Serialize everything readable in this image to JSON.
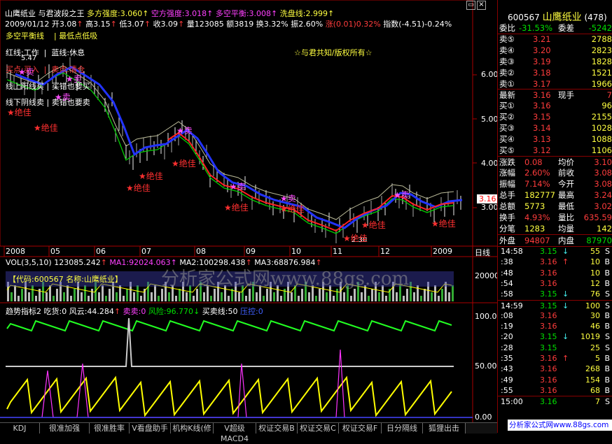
{
  "header": {
    "stock": "山鹰纸业",
    "indicator": "与君波段之王",
    "duo_label": "多方强度:3.060",
    "kong_label": "空方强度:3.018",
    "duokong_label": "多空平衡:3.008",
    "wash_label": "洗盘线:2.999",
    "date_line": "2009/01/12",
    "open": "开3.08",
    "high": "高3.15",
    "low": "低3.07",
    "close": "收3.09",
    "volume": "量123085",
    "amount": "额3819",
    "turnover": "换3.32%",
    "amplitude": "振2.60%",
    "change": "涨(0.01)0.32%",
    "index": "指数(-4.51)-0.24%"
  },
  "legend": {
    "balance": "多空平衡线",
    "lowest": "最低点低吸",
    "red": "红线:工作",
    "blue": "蓝线:休息",
    "buy": "买点:买入",
    "sell": "卖点:清仓",
    "up": "线上阳线买",
    "up_err": "买错也要买",
    "down": "线下阴线卖",
    "down_err": "卖错也要卖",
    "copyright": "☆与君共知/版权所有☆",
    "tag_peak": "5.47",
    "tag_low": "2.30"
  },
  "marks": {
    "sell": "★卖",
    "best": "★绝佳"
  },
  "price_axis": [
    "6.00",
    "5.00",
    "4.00",
    "3.00"
  ],
  "price_current": "3.16",
  "time_axis": [
    "2008",
    "05",
    "06",
    "07",
    "08",
    "09",
    "10",
    "11",
    "12",
    "2009"
  ],
  "time_axis_label": "日线",
  "vol": {
    "label": "VOL(3,5,10)",
    "value": "123085.242",
    "ma1": "MA1:92024.063",
    "ma2": "MA2:100298.438",
    "ma3": "MA3:68876.984",
    "code_box": "【代码:600567 名称:山鹰纸业】",
    "watermark": "分析家公式网www.88gs.com",
    "axis": "200000"
  },
  "trend": {
    "label": "趋势指标2",
    "eat": "吃货:0",
    "wind": "风云:44.284",
    "sell": "卖卖:0",
    "risk": "风险:96.770",
    "buysell": "买卖线:50",
    "pressure": "压控:0",
    "axis": [
      "100.00",
      "50.00",
      "0.00"
    ]
  },
  "tabs": [
    "KDJ",
    "很准加强",
    "很准胜率",
    "V看盘助手",
    "机构K线(修",
    "V超级MACD4",
    "权证交易B",
    "权证交易C",
    "权证交易F",
    "日分隔线",
    "狐狸出击"
  ],
  "panel": {
    "code": "600567",
    "name": "山鹰纸业",
    "num": "(478)",
    "webi_label": "委比",
    "webi": "-31.53%",
    "wecha_label": "委差",
    "wecha": "-5242",
    "asks": [
      {
        "label": "卖⑤",
        "price": "3.21",
        "vol": "2788"
      },
      {
        "label": "卖④",
        "price": "3.20",
        "vol": "2823"
      },
      {
        "label": "卖③",
        "price": "3.19",
        "vol": "1828"
      },
      {
        "label": "卖②",
        "price": "3.18",
        "vol": "1521"
      },
      {
        "label": "卖①",
        "price": "3.17",
        "vol": "1966"
      }
    ],
    "last_label": "最新",
    "last": "3.16",
    "hand_label": "现手",
    "hand": "7",
    "bids": [
      {
        "label": "买①",
        "price": "3.16",
        "vol": "96"
      },
      {
        "label": "买②",
        "price": "3.15",
        "vol": "2155"
      },
      {
        "label": "买③",
        "price": "3.14",
        "vol": "1028"
      },
      {
        "label": "买④",
        "price": "3.13",
        "vole": "",
        "vol": "1088"
      },
      {
        "label": "买⑤",
        "price": "3.12",
        "vol": "1106"
      }
    ],
    "stats": [
      {
        "l1": "涨跌",
        "v1": "0.08",
        "l2": "均价",
        "v2": "3.10"
      },
      {
        "l1": "涨幅",
        "v1": "2.60%",
        "l2": "前收",
        "v2": "3.08"
      },
      {
        "l1": "振幅",
        "v1": "7.14%",
        "l2": "今开",
        "v2": "3.08"
      },
      {
        "l1": "总手",
        "v1": "182777",
        "l2": "最高",
        "v2": "3.24"
      },
      {
        "l1": "总额",
        "v1": "5773",
        "l2": "最低",
        "v2": "3.02"
      },
      {
        "l1": "换手",
        "v1": "4.93%",
        "l2": "量比",
        "v2": "635.59"
      },
      {
        "l1": "分笔",
        "v1": "1283",
        "l2": "均量",
        "v2": "142"
      }
    ],
    "outer_label": "外盘",
    "outer": "94807",
    "inner_label": "内盘",
    "inner": "87970",
    "ticks": [
      {
        "t": "14:58",
        "p": "3.15",
        "a": "↓",
        "v": "55",
        "s": "S"
      },
      {
        "t": ":38",
        "p": "3.16",
        "a": "↑",
        "v": "10",
        "s": "B"
      },
      {
        "t": ":48",
        "p": "3.16",
        "a": "",
        "v": "10",
        "s": "B"
      },
      {
        "t": ":54",
        "p": "3.16",
        "a": "",
        "v": "12",
        "s": "B"
      },
      {
        "t": ":58",
        "p": "3.15",
        "a": "↓",
        "v": "76",
        "s": "S"
      },
      {
        "t": "14:59",
        "p": "3.15",
        "a": "↓",
        "v": "100",
        "s": "S"
      },
      {
        "t": ":08",
        "p": "3.16",
        "a": "",
        "v": "30",
        "s": "B"
      },
      {
        "t": ":19",
        "p": "3.16",
        "a": "",
        "v": "46",
        "s": "B"
      },
      {
        "t": ":20",
        "p": "3.15",
        "a": "↓",
        "v": "1019",
        "s": "S"
      },
      {
        "t": ":28",
        "p": "3.15",
        "a": "",
        "v": "25",
        "s": "S"
      },
      {
        "t": ":35",
        "p": "3.16",
        "a": "↑",
        "v": "5",
        "s": "B"
      },
      {
        "t": ":43",
        "p": "3.16",
        "a": "",
        "v": "268",
        "s": "B"
      },
      {
        "t": ":49",
        "p": "3.16",
        "a": "",
        "v": "154",
        "s": "B"
      },
      {
        "t": ":55",
        "p": "3.16",
        "a": "",
        "v": "68",
        "s": "B"
      },
      {
        "t": "15:00",
        "p": "3.16",
        "a": "",
        "v": "7",
        "s": "S"
      }
    ],
    "footer": "分析家公式网www.88gs.com"
  }
}
